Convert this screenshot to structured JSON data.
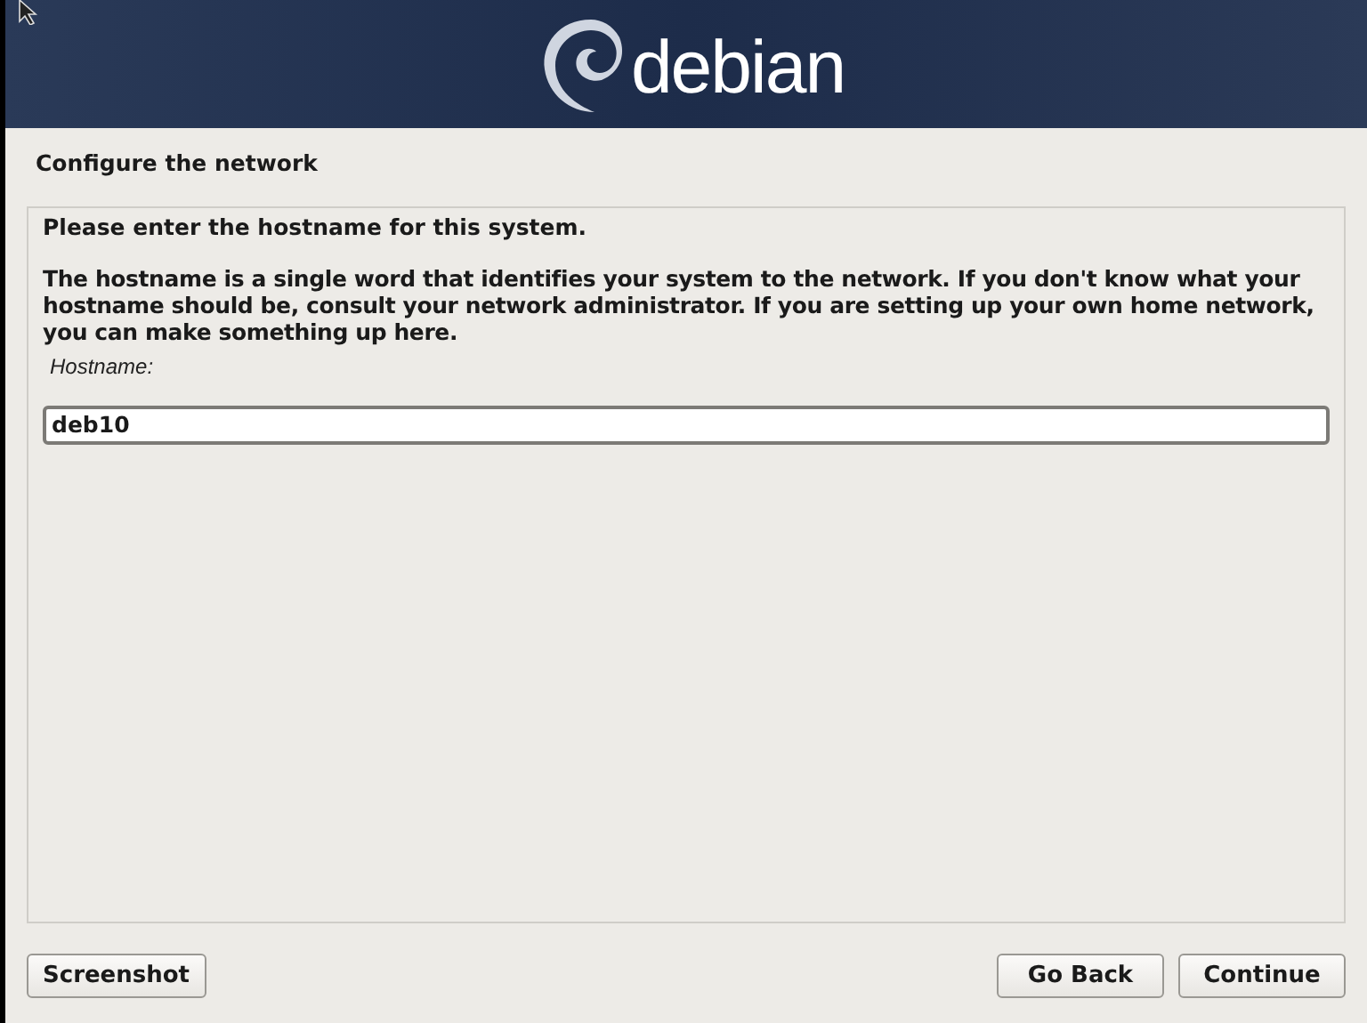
{
  "header": {
    "logo_text": "debian"
  },
  "step_title": "Configure the network",
  "prompt": "Please enter the hostname for this system.",
  "description": "The hostname is a single word that identifies your system to the network. If you don't know what your hostname should be, consult your network administrator. If you are setting up your own home network, you can make something up here.",
  "field": {
    "label": "Hostname:",
    "value": "deb10"
  },
  "buttons": [
    {
      "label": "Screenshot",
      "kind": "left"
    },
    {
      "label": "Go Back",
      "kind": "right"
    },
    {
      "label": "Continue",
      "kind": "right"
    }
  ]
}
